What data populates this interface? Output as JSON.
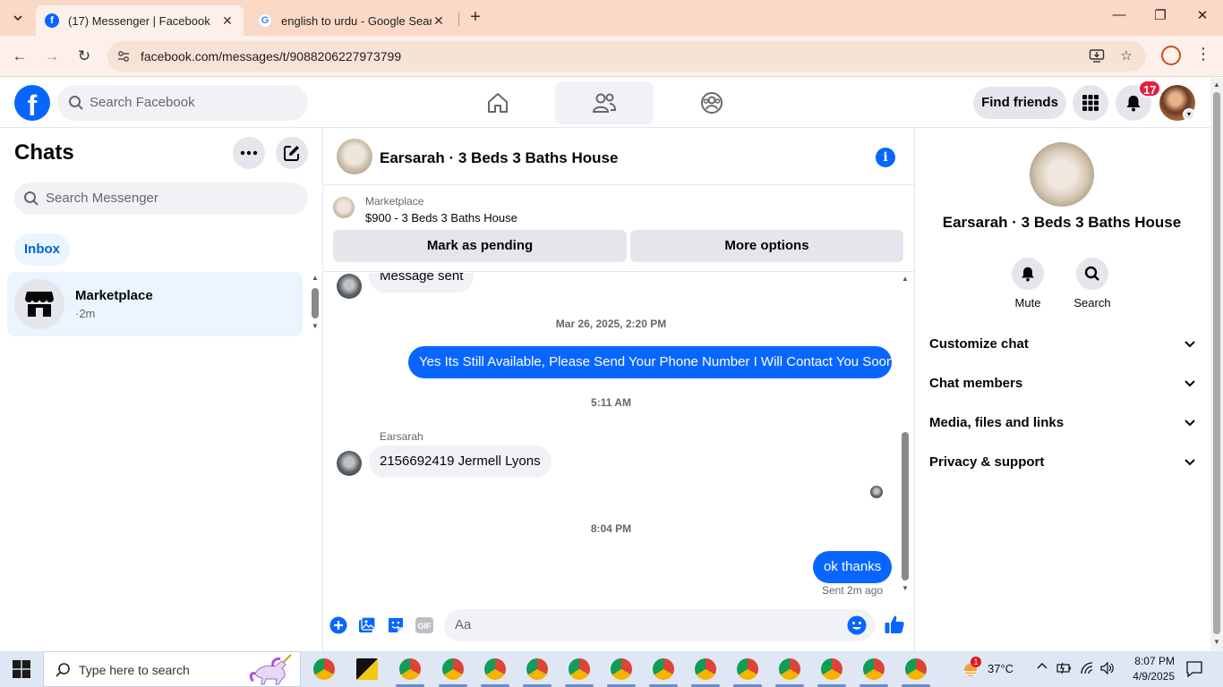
{
  "browser": {
    "tabs": [
      {
        "title": "(17) Messenger | Facebook",
        "active": true
      },
      {
        "title": "english to urdu - Google Search",
        "active": false
      }
    ],
    "url": "facebook.com/messages/t/9088206227973799"
  },
  "fb_nav": {
    "search_placeholder": "Search Facebook",
    "find_friends_label": "Find friends",
    "notification_count": "17",
    "brand_color": "#0866ff"
  },
  "chats": {
    "title": "Chats",
    "search_placeholder": "Search Messenger",
    "filter_label": "Inbox",
    "items": [
      {
        "name": "Marketplace",
        "meta": "·2m"
      }
    ]
  },
  "conversation": {
    "title": "Earsarah · 3 Beds 3 Baths House",
    "marketplace_label": "Marketplace",
    "listing_price": "$900 - 3 Beds 3 Baths House",
    "mark_pending_label": "Mark as pending",
    "more_options_label": "More options",
    "messages": {
      "first_incoming": "Message sent",
      "timestamp_1": "Mar 26, 2025, 2:20 PM",
      "outgoing_1": "Yes Its Still Available, Please Send Your Phone Number I Will Contact You Soon",
      "timestamp_2": "5:11 AM",
      "sender_name": "Earsarah",
      "incoming_2": "2156692419 Jermell Lyons",
      "timestamp_3": "8:04 PM",
      "outgoing_2": "ok thanks",
      "sent_status": "Sent 2m ago"
    },
    "composer_placeholder": "Aa"
  },
  "info_panel": {
    "name": "Earsarah · 3 Beds 3 Baths House",
    "actions": [
      {
        "label": "Mute",
        "icon": "bell-icon"
      },
      {
        "label": "Search",
        "icon": "search-icon"
      }
    ],
    "sections": [
      {
        "label": "Customize chat"
      },
      {
        "label": "Chat members"
      },
      {
        "label": "Media, files and links"
      },
      {
        "label": "Privacy & support"
      }
    ]
  },
  "taskbar": {
    "search_placeholder": "Type here to search",
    "weather": "37°C",
    "weather_badge": "1",
    "time": "8:07 PM",
    "date": "4/9/2025"
  }
}
